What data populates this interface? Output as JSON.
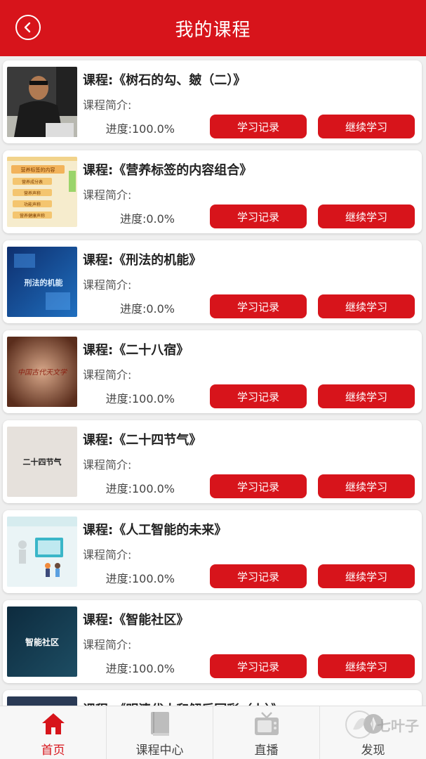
{
  "header": {
    "title": "我的课程"
  },
  "labels": {
    "intro": "课程简介:",
    "record_btn": "学习记录",
    "continue_btn": "继续学习"
  },
  "courses": [
    {
      "title": "课程:《树石的勾、皴（二）》",
      "progress": "进度:100.0%"
    },
    {
      "title": "课程:《营养标签的内容组合》",
      "progress": "进度:0.0%"
    },
    {
      "title": "课程:《刑法的机能》",
      "progress": "进度:0.0%"
    },
    {
      "title": "课程:《二十八宿》",
      "progress": "进度:100.0%"
    },
    {
      "title": "课程:《二十四节气》",
      "progress": "进度:100.0%"
    },
    {
      "title": "课程:《人工智能的未来》",
      "progress": "进度:100.0%"
    },
    {
      "title": "课程:《智能社区》",
      "progress": "进度:100.0%"
    },
    {
      "title": "课程:《明清代大和解后回彩（上）》",
      "progress": ""
    }
  ],
  "thumb_text": {
    "nutrition": [
      "营养标签的内容",
      "营养成分表",
      "营养声称",
      "功能声称",
      "营养健康声称"
    ],
    "criminal": "刑法的机能",
    "mansions": "中国古代天文学",
    "solar_terms": "二十四节气",
    "community": "智能社区"
  },
  "tabs": [
    {
      "label": "首页",
      "icon": "home-icon",
      "active": true
    },
    {
      "label": "课程中心",
      "icon": "book-icon",
      "active": false
    },
    {
      "label": "直播",
      "icon": "tv-icon",
      "active": false
    },
    {
      "label": "发现",
      "icon": "discover-icon",
      "active": false
    }
  ],
  "watermark": "七叶子",
  "colors": {
    "accent": "#d7141b",
    "background": "#efefef"
  }
}
